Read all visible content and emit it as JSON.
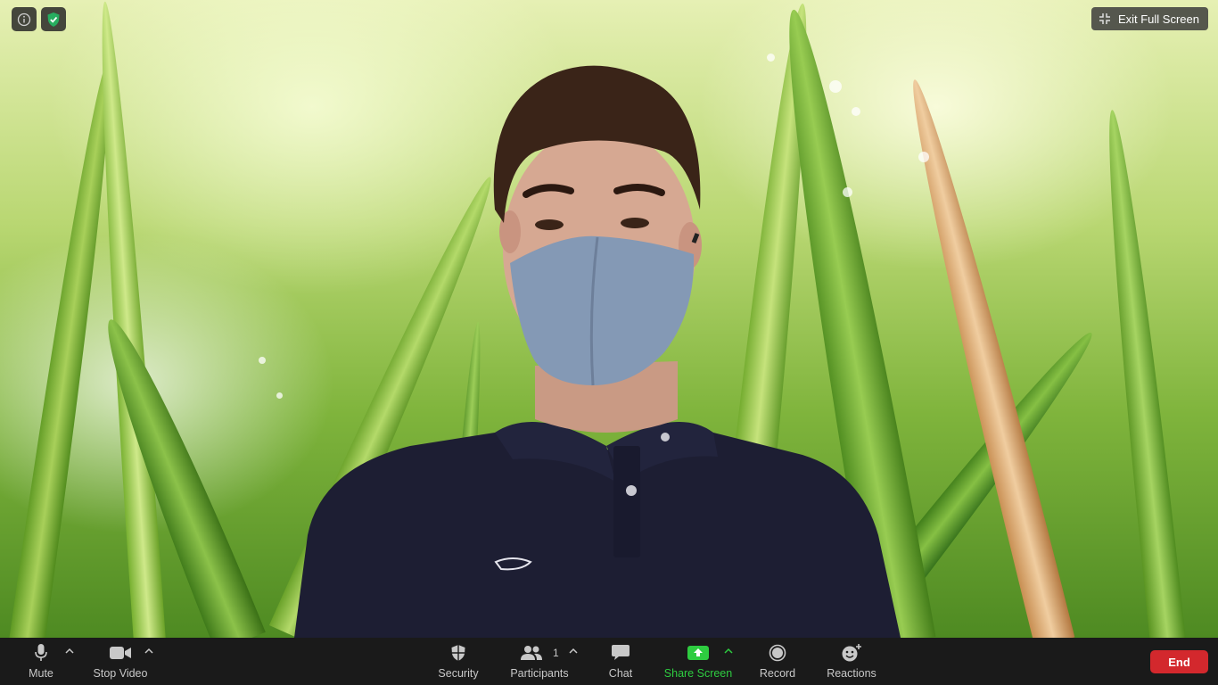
{
  "top_bar": {
    "exit_full_screen_label": "Exit Full Screen",
    "info_icon": "info-icon",
    "encryption_icon": "shield-check-icon"
  },
  "toolbar": {
    "mute_label": "Mute",
    "stop_video_label": "Stop Video",
    "security_label": "Security",
    "participants_label": "Participants",
    "participants_count": "1",
    "chat_label": "Chat",
    "share_screen_label": "Share Screen",
    "record_label": "Record",
    "reactions_label": "Reactions",
    "end_label": "End"
  },
  "colors": {
    "toolbar_bg": "#1a1a1a",
    "share_green": "#2ecc40",
    "end_red": "#d3282d",
    "encryption_green": "#27ae60"
  }
}
